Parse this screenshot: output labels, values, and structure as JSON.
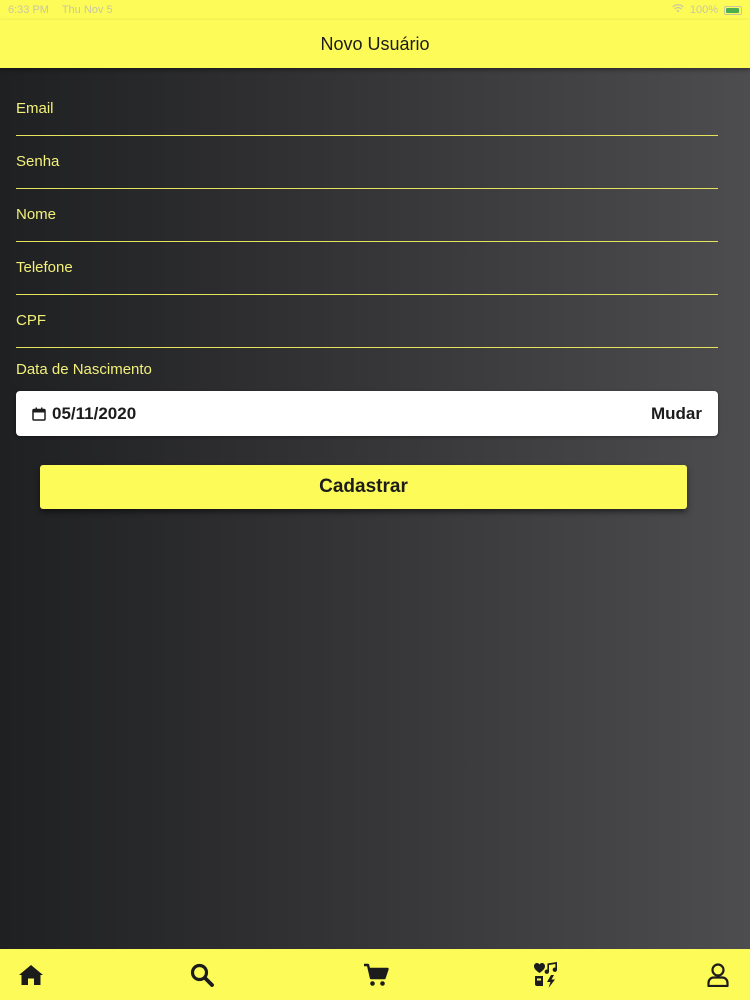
{
  "status_bar": {
    "time": "6:33 PM",
    "date": "Thu Nov 5",
    "battery": "100%"
  },
  "header": {
    "title": "Novo Usuário"
  },
  "form": {
    "fields": [
      {
        "label": "Email"
      },
      {
        "label": "Senha"
      },
      {
        "label": "Nome"
      },
      {
        "label": "Telefone"
      },
      {
        "label": "CPF"
      }
    ],
    "dob_label": "Data de Nascimento",
    "dob_value": "05/11/2020",
    "change_label": "Mudar",
    "submit_label": "Cadastrar"
  },
  "tabbar": {
    "items": [
      {
        "icon": "home-icon"
      },
      {
        "icon": "search-icon"
      },
      {
        "icon": "cart-icon"
      },
      {
        "icon": "heart-music-icon"
      },
      {
        "icon": "user-icon"
      }
    ]
  },
  "colors": {
    "accent": "#fdfb57",
    "label": "#f2f07a",
    "background_dark": "#1f2022",
    "background_light": "#4d4d4f"
  }
}
